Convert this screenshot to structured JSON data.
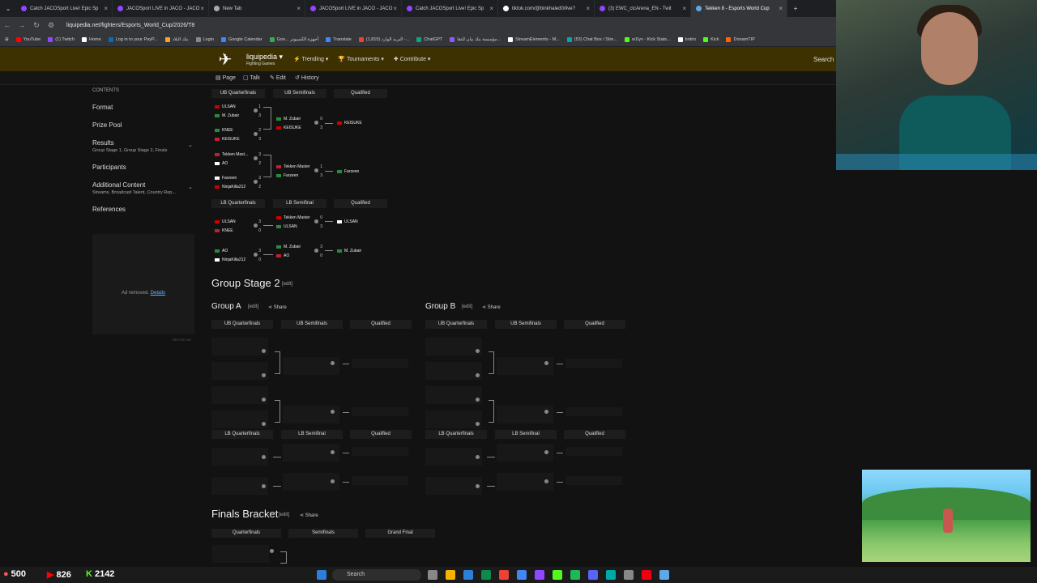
{
  "browser": {
    "tabs": [
      {
        "title": "Catch JACOSport Live! Epic Sp",
        "color": "#9146ff"
      },
      {
        "title": "JACOSport LIVE in JACO - JACO",
        "color": "#9146ff"
      },
      {
        "title": "New Tab",
        "color": "#aaaaaa"
      },
      {
        "title": "JACOSport LIVE in JACO - JACO",
        "color": "#9146ff"
      },
      {
        "title": "Catch JACOSport Live! Epic Sp",
        "color": "#9146ff"
      },
      {
        "title": "tiktok.com/@binkhaled0/live?",
        "color": "#ffffff"
      },
      {
        "title": "(3) EWC_ctcArena_EN - Twit",
        "color": "#9146ff"
      },
      {
        "title": "Tekken 8 - Esports World Cup",
        "color": "#5fa8e6"
      }
    ],
    "close_glyph": "×",
    "new_tab": "+",
    "url": "liquipedia.net/fighters/Esports_World_Cup/2026/T8",
    "bookmarks": [
      {
        "label": "YouTube",
        "color": "#ff0000"
      },
      {
        "label": "(1) Twitch",
        "color": "#9146ff"
      },
      {
        "label": "Home",
        "color": "#ffffff"
      },
      {
        "label": "Log in to your PayP...",
        "color": "#0070ba"
      },
      {
        "label": "بنك البلاد",
        "color": "#f5a623"
      },
      {
        "label": "Login",
        "color": "#888888"
      },
      {
        "label": "Google Calendar",
        "color": "#4285f4"
      },
      {
        "label": "Goo... أجهزة الكمبيوتر",
        "color": "#34a853"
      },
      {
        "label": "Translate",
        "color": "#4285f4"
      },
      {
        "label": "(1,815) البريد الوارد -...",
        "color": "#ea4335"
      },
      {
        "label": "ChatGPT",
        "color": "#10a37f"
      },
      {
        "label": "مؤسسة بنك بيان للتقا...",
        "color": "#8b5cf6"
      },
      {
        "label": "StreamElements - M...",
        "color": "#ffffff"
      },
      {
        "label": "(53) Chat Box / Stre...",
        "color": "#0aa"
      },
      {
        "label": "w1lyv - Kick Stats...",
        "color": "#53fc18"
      },
      {
        "label": "botrix",
        "color": "#ffffff"
      },
      {
        "label": "Kick",
        "color": "#53fc18"
      },
      {
        "label": "DonamTIP",
        "color": "#ff6600"
      }
    ]
  },
  "liquipedia": {
    "brand": "liquipedia",
    "brand_sub": "Fighting Games",
    "menu": [
      "Trending",
      "Tournaments",
      "Contribute"
    ],
    "search": "Search",
    "subnav": [
      "Page",
      "Talk",
      "Edit",
      "History"
    ]
  },
  "toc": {
    "heading": "CONTENTS",
    "items": [
      {
        "label": "Format",
        "sub": ""
      },
      {
        "label": "Prize Pool",
        "sub": ""
      },
      {
        "label": "Results",
        "sub": "Group Stage 1, Group Stage 2, Finals"
      },
      {
        "label": "Participants",
        "sub": ""
      },
      {
        "label": "Additional Content",
        "sub": "Streams, Broadcast Talent, Country Rep..."
      },
      {
        "label": "References",
        "sub": ""
      }
    ],
    "chevron": "⌄"
  },
  "ad": {
    "text": "Ad removed.",
    "link": "Details",
    "report": "REPORT AD"
  },
  "stage1": {
    "ub_headers": [
      "UB Quarterfinals",
      "UB Semifinals",
      "Qualified"
    ],
    "lb_headers": [
      "LB Quarterfinals",
      "LB Semifinal",
      "Qualified"
    ],
    "ub_qf": [
      {
        "p1": "ULSAN",
        "s1": "1",
        "p2": "M. Zubair",
        "s2": "3"
      },
      {
        "p1": "KNEE",
        "s1": "2",
        "p2": "KEISUKE",
        "s2": "3"
      },
      {
        "p1": "Tekken Mast...",
        "s1": "3",
        "p2": "AO",
        "s2": "2"
      },
      {
        "p1": "Farzeen",
        "s1": "3",
        "p2": "NinjaKilla212",
        "s2": "2"
      }
    ],
    "ub_sf": [
      {
        "p1": "M. Zubair",
        "s1": "0",
        "p2": "KEISUKE",
        "s2": "3"
      },
      {
        "p1": "Tekken Master",
        "s1": "1",
        "p2": "Farzeen",
        "s2": "3"
      }
    ],
    "ub_q": [
      "KEISUKE",
      "Farzeen"
    ],
    "lb_qf": [
      {
        "p1": "ULSAN",
        "s1": "3",
        "p2": "KNEE",
        "s2": "0"
      },
      {
        "p1": "AO",
        "s1": "3",
        "p2": "NinjaKilla212",
        "s2": "0"
      }
    ],
    "lb_sf": [
      {
        "p1": "Tekken Master",
        "s1": "0",
        "p2": "ULSAN",
        "s2": "3"
      },
      {
        "p1": "M. Zubair",
        "s1": "3",
        "p2": "AO",
        "s2": "0"
      }
    ],
    "lb_q": [
      "ULSAN",
      "M. Zubair"
    ]
  },
  "stage2": {
    "title": "Group Stage 2",
    "edit": "edit",
    "share": "Share",
    "group_a": "Group A",
    "group_b": "Group B",
    "ub_headers": [
      "UB Quarterfinals",
      "UB Semifinals",
      "Qualified"
    ],
    "lb_headers": [
      "LB Quarterfinals",
      "LB Semifinal",
      "Qualified"
    ]
  },
  "finals": {
    "title": "Finals Bracket",
    "headers": [
      "Quarterfinals",
      "Semifinals",
      "Grand Final"
    ]
  },
  "stream_overlay": {
    "stat1": "500",
    "stat2": "826",
    "stat3": "2142"
  },
  "taskbar": {
    "search": "Search"
  }
}
